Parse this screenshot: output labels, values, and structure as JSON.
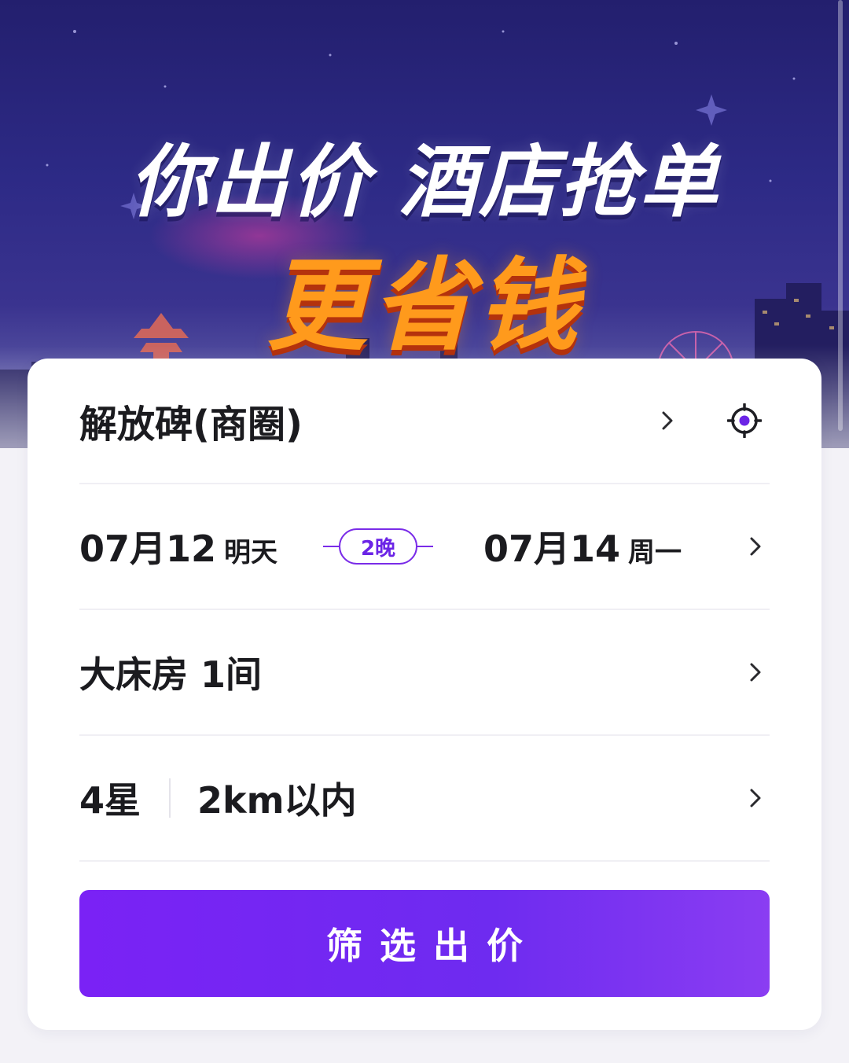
{
  "banner": {
    "headline_left": "你出价",
    "headline_right": "酒店抢单",
    "subline": "更省钱"
  },
  "search": {
    "location": "解放碑(商圈)",
    "location_icon": "locate-target-icon",
    "checkin_date": "07月12",
    "checkin_day": "明天",
    "nights": "2晚",
    "checkout_date": "07月14",
    "checkout_day": "周一",
    "room": "大床房 1间",
    "star": "4星",
    "distance": "2km以内",
    "submit_label": "筛选出价"
  },
  "colors": {
    "accent": "#7a22f5",
    "banner_bg": "#2d2a86",
    "subline": "#ff9a1c",
    "text": "#1b1b1f"
  }
}
